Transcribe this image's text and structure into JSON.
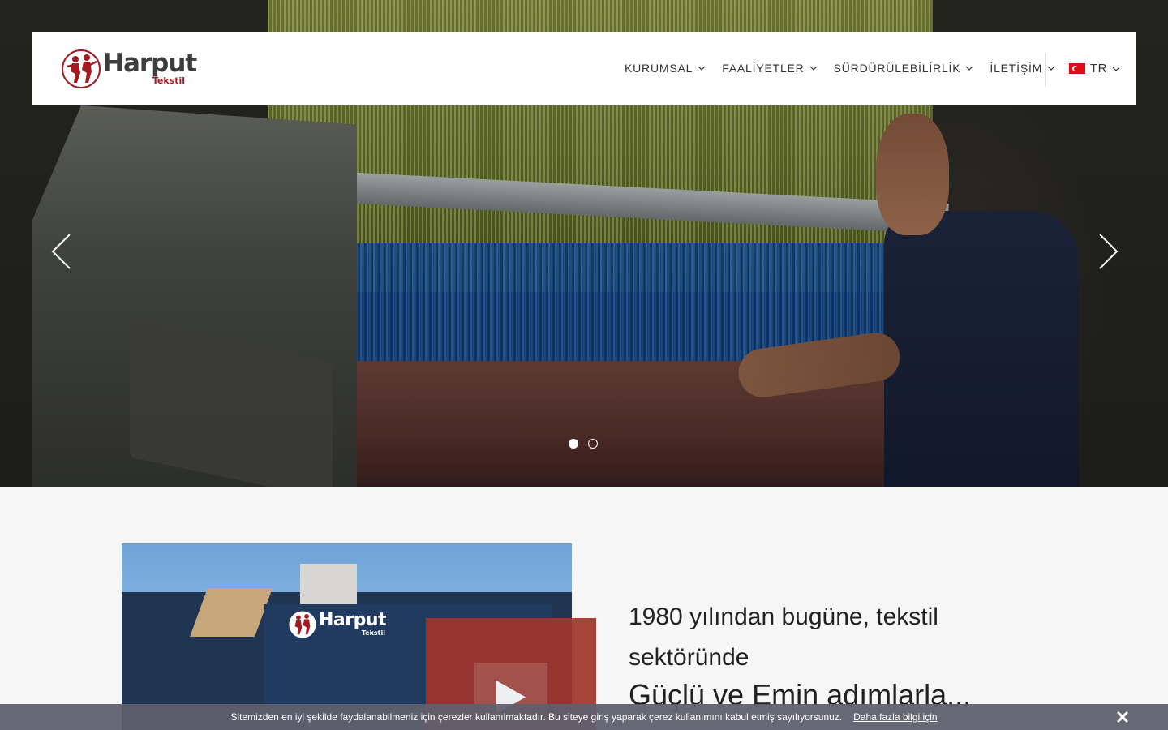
{
  "header": {
    "logo": {
      "word": "Harput",
      "sub": "Tekstil"
    },
    "nav": [
      {
        "label": "KURUMSAL"
      },
      {
        "label": "FAALİYETLER"
      },
      {
        "label": "SÜRDÜRÜLEBİLİRLİK"
      },
      {
        "label": "İLETİŞİM"
      }
    ],
    "language": {
      "label": "TR",
      "flag_icon": "turkey-flag-icon"
    }
  },
  "slider": {
    "slides_count": 2,
    "active_slide": 1,
    "prev_icon": "chevron-left-icon",
    "next_icon": "chevron-right-icon"
  },
  "about": {
    "image_sign": {
      "word": "Harput",
      "sub": "Tekstil"
    },
    "video_icon": "play-icon",
    "tagline_line1": "1980 yılından bugüne, tekstil sektöründe",
    "tagline_line2": "Güçlü ve Emin adımlarla..."
  },
  "cookie_bar": {
    "text": "Sitemizden en iyi şekilde faydalanabilmeniz için çerezler kullanılmaktadır. Bu siteye giriş yaparak çerez kullanımını kabul etmiş sayılıyorsunuz.",
    "link": "Daha fazla bilgi için",
    "close_icon": "close-x-icon"
  },
  "colors": {
    "brand_red": "#a11b21",
    "logo_text": "#3d3d3d",
    "cookie_bg": "#5f606d",
    "video_red": "#a1352b"
  }
}
